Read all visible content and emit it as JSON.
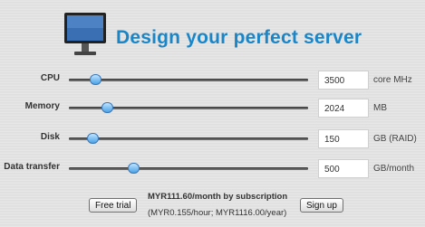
{
  "header": {
    "title": "Design your perfect server",
    "icon": "monitor-icon"
  },
  "sliders": [
    {
      "id": "cpu",
      "label": "CPU",
      "value": "3500",
      "unit": "core MHz",
      "position": 0.11
    },
    {
      "id": "memory",
      "label": "Memory",
      "value": "2024",
      "unit": "MB",
      "position": 0.16
    },
    {
      "id": "disk",
      "label": "Disk",
      "value": "150",
      "unit": "GB (RAID)",
      "position": 0.1
    },
    {
      "id": "data-transfer",
      "label": "Data transfer",
      "value": "500",
      "unit": "GB/month",
      "position": 0.27
    }
  ],
  "pricing": {
    "monthly": "MYR111.60/month by subscription",
    "detail": "(MYR0.155/hour; MYR1116.00/year)"
  },
  "actions": {
    "free_trial": "Free trial",
    "sign_up": "Sign up"
  },
  "colors": {
    "accent": "#1a86c8",
    "thumb": "#4aa3e8"
  }
}
